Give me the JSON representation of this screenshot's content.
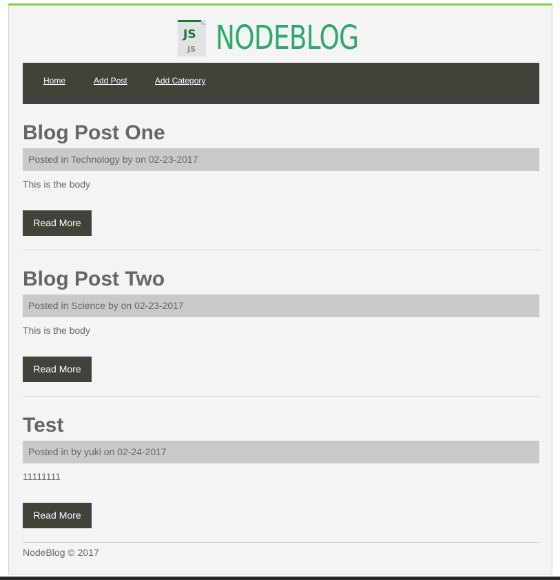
{
  "header": {
    "logo_icon_text_top": "JS",
    "logo_icon_text_bottom": "JS",
    "brand": "NODEBLOG"
  },
  "nav": {
    "items": [
      {
        "label": "Home"
      },
      {
        "label": "Add Post"
      },
      {
        "label": "Add Category"
      }
    ]
  },
  "posts": [
    {
      "title": "Blog Post One",
      "meta": "Posted in Technology by on 02-23-2017",
      "body": "This is the body",
      "read_more": "Read More"
    },
    {
      "title": "Blog Post Two",
      "meta": "Posted in Science by on 02-23-2017",
      "body": "This is the body",
      "read_more": "Read More"
    },
    {
      "title": "Test",
      "meta": "Posted in by yuki on 02-24-2017",
      "body": "11111111",
      "read_more": "Read More"
    }
  ],
  "footer": {
    "text": "NodeBlog © 2017"
  },
  "colors": {
    "accent_border": "#7ed33b",
    "brand_green": "#2daa6a",
    "nav_background": "#41423a",
    "meta_background": "#c9c9c9",
    "page_background": "#f4f4f4"
  }
}
